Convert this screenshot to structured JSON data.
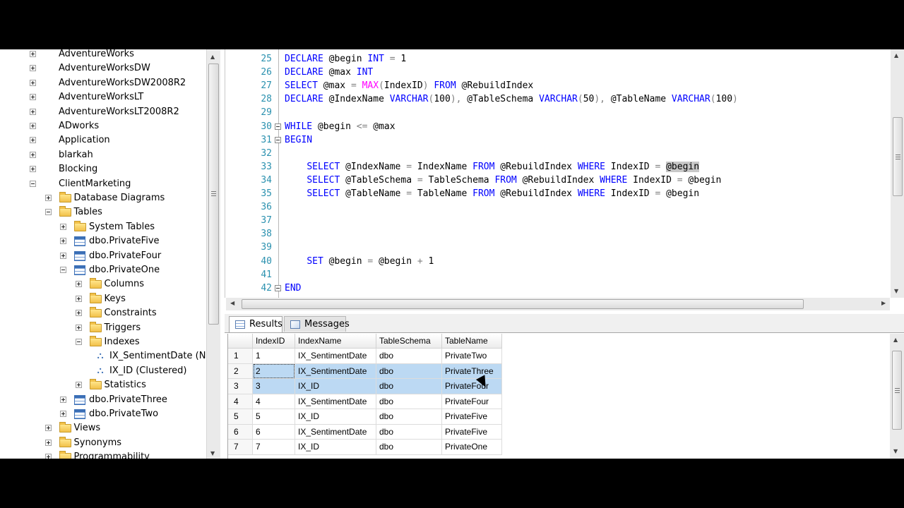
{
  "explorer": {
    "items": [
      {
        "label": "AdventureWorks",
        "icon": "database-icon",
        "expander": "plus",
        "level": 0
      },
      {
        "label": "AdventureWorksDW",
        "icon": "database-icon",
        "expander": "plus",
        "level": 0
      },
      {
        "label": "AdventureWorksDW2008R2",
        "icon": "database-icon",
        "expander": "plus",
        "level": 0
      },
      {
        "label": "AdventureWorksLT",
        "icon": "database-icon",
        "expander": "plus",
        "level": 0
      },
      {
        "label": "AdventureWorksLT2008R2",
        "icon": "database-icon",
        "expander": "plus",
        "level": 0
      },
      {
        "label": "ADworks",
        "icon": "database-icon",
        "expander": "plus",
        "level": 0
      },
      {
        "label": "Application",
        "icon": "database-icon",
        "expander": "plus",
        "level": 0
      },
      {
        "label": "blarkah",
        "icon": "database-icon",
        "expander": "plus",
        "level": 0
      },
      {
        "label": "Blocking",
        "icon": "database-icon",
        "expander": "plus",
        "level": 0
      },
      {
        "label": "ClientMarketing",
        "icon": "database-icon",
        "expander": "minus",
        "level": 0
      },
      {
        "label": "Database Diagrams",
        "icon": "folder-icon",
        "expander": "plus",
        "level": 1
      },
      {
        "label": "Tables",
        "icon": "folder-icon",
        "expander": "minus",
        "level": 1
      },
      {
        "label": "System Tables",
        "icon": "folder-icon",
        "expander": "plus",
        "level": 2
      },
      {
        "label": "dbo.PrivateFive",
        "icon": "table-icon",
        "expander": "plus",
        "level": 2
      },
      {
        "label": "dbo.PrivateFour",
        "icon": "table-icon",
        "expander": "plus",
        "level": 2
      },
      {
        "label": "dbo.PrivateOne",
        "icon": "table-icon",
        "expander": "minus",
        "level": 2
      },
      {
        "label": "Columns",
        "icon": "folder-icon",
        "expander": "plus",
        "level": 3
      },
      {
        "label": "Keys",
        "icon": "folder-icon",
        "expander": "plus",
        "level": 3
      },
      {
        "label": "Constraints",
        "icon": "folder-icon",
        "expander": "plus",
        "level": 3
      },
      {
        "label": "Triggers",
        "icon": "folder-icon",
        "expander": "plus",
        "level": 3
      },
      {
        "label": "Indexes",
        "icon": "folder-icon",
        "expander": "minus",
        "level": 3
      },
      {
        "label": "IX_SentimentDate (N",
        "icon": "index-icon",
        "expander": "none",
        "level": 4
      },
      {
        "label": "IX_ID (Clustered)",
        "icon": "index-icon",
        "expander": "none",
        "level": 4
      },
      {
        "label": "Statistics",
        "icon": "folder-icon",
        "expander": "plus",
        "level": 3
      },
      {
        "label": "dbo.PrivateThree",
        "icon": "table-icon",
        "expander": "plus",
        "level": 2
      },
      {
        "label": "dbo.PrivateTwo",
        "icon": "table-icon",
        "expander": "plus",
        "level": 2
      },
      {
        "label": "Views",
        "icon": "folder-icon",
        "expander": "plus",
        "level": 1
      },
      {
        "label": "Synonyms",
        "icon": "folder-icon",
        "expander": "plus",
        "level": 1
      },
      {
        "label": "Programmability",
        "icon": "folder-icon",
        "expander": "plus",
        "level": 1
      }
    ]
  },
  "editor": {
    "lines": [
      {
        "num": "25",
        "fold": false,
        "tokens": [
          [
            "k",
            "DECLARE"
          ],
          [
            "t",
            " @begin "
          ],
          [
            "k",
            "INT"
          ],
          [
            "t",
            " "
          ],
          [
            "g",
            "="
          ],
          [
            "t",
            " 1"
          ]
        ]
      },
      {
        "num": "26",
        "fold": false,
        "tokens": [
          [
            "k",
            "DECLARE"
          ],
          [
            "t",
            " @max "
          ],
          [
            "k",
            "INT"
          ]
        ]
      },
      {
        "num": "27",
        "fold": false,
        "tokens": [
          [
            "k",
            "SELECT"
          ],
          [
            "t",
            " @max "
          ],
          [
            "g",
            "="
          ],
          [
            "t",
            " "
          ],
          [
            "f",
            "MAX"
          ],
          [
            "g",
            "("
          ],
          [
            "t",
            "IndexID"
          ],
          [
            "g",
            ")"
          ],
          [
            "t",
            " "
          ],
          [
            "k",
            "FROM"
          ],
          [
            "t",
            " @RebuildIndex"
          ]
        ]
      },
      {
        "num": "28",
        "fold": false,
        "tokens": [
          [
            "k",
            "DECLARE"
          ],
          [
            "t",
            " @IndexName "
          ],
          [
            "k",
            "VARCHAR"
          ],
          [
            "g",
            "("
          ],
          [
            "t",
            "100"
          ],
          [
            "g",
            ")"
          ],
          [
            "g",
            ","
          ],
          [
            "t",
            " @TableSchema "
          ],
          [
            "k",
            "VARCHAR"
          ],
          [
            "g",
            "("
          ],
          [
            "t",
            "50"
          ],
          [
            "g",
            ")"
          ],
          [
            "g",
            ","
          ],
          [
            "t",
            " @TableName "
          ],
          [
            "k",
            "VARCHAR"
          ],
          [
            "g",
            "("
          ],
          [
            "t",
            "100"
          ],
          [
            "g",
            ")"
          ]
        ]
      },
      {
        "num": "29",
        "fold": false,
        "tokens": []
      },
      {
        "num": "30",
        "fold": true,
        "tokens": [
          [
            "k",
            "WHILE"
          ],
          [
            "t",
            " @begin "
          ],
          [
            "g",
            "<="
          ],
          [
            "t",
            " @max"
          ]
        ]
      },
      {
        "num": "31",
        "fold": true,
        "tokens": [
          [
            "k",
            "BEGIN"
          ]
        ]
      },
      {
        "num": "32",
        "fold": false,
        "tokens": []
      },
      {
        "num": "33",
        "fold": false,
        "tokens": [
          [
            "t",
            "    "
          ],
          [
            "k",
            "SELECT"
          ],
          [
            "t",
            " @IndexName "
          ],
          [
            "g",
            "="
          ],
          [
            "t",
            " IndexName "
          ],
          [
            "k",
            "FROM"
          ],
          [
            "t",
            " @RebuildIndex "
          ],
          [
            "k",
            "WHERE"
          ],
          [
            "t",
            " IndexID "
          ],
          [
            "g",
            "="
          ],
          [
            "t",
            " "
          ],
          [
            "hl",
            "@begin"
          ]
        ]
      },
      {
        "num": "34",
        "fold": false,
        "tokens": [
          [
            "t",
            "    "
          ],
          [
            "k",
            "SELECT"
          ],
          [
            "t",
            " @TableSchema "
          ],
          [
            "g",
            "="
          ],
          [
            "t",
            " TableSchema "
          ],
          [
            "k",
            "FROM"
          ],
          [
            "t",
            " @RebuildIndex "
          ],
          [
            "k",
            "WHERE"
          ],
          [
            "t",
            " IndexID "
          ],
          [
            "g",
            "="
          ],
          [
            "t",
            " @begin"
          ]
        ]
      },
      {
        "num": "35",
        "fold": false,
        "tokens": [
          [
            "t",
            "    "
          ],
          [
            "k",
            "SELECT"
          ],
          [
            "t",
            " @TableName "
          ],
          [
            "g",
            "="
          ],
          [
            "t",
            " TableName "
          ],
          [
            "k",
            "FROM"
          ],
          [
            "t",
            " @RebuildIndex "
          ],
          [
            "k",
            "WHERE"
          ],
          [
            "t",
            " IndexID "
          ],
          [
            "g",
            "="
          ],
          [
            "t",
            " @begin"
          ]
        ]
      },
      {
        "num": "36",
        "fold": false,
        "tokens": []
      },
      {
        "num": "37",
        "fold": false,
        "tokens": []
      },
      {
        "num": "38",
        "fold": false,
        "tokens": []
      },
      {
        "num": "39",
        "fold": false,
        "tokens": []
      },
      {
        "num": "40",
        "fold": false,
        "tokens": [
          [
            "t",
            "    "
          ],
          [
            "k",
            "SET"
          ],
          [
            "t",
            " @begin "
          ],
          [
            "g",
            "="
          ],
          [
            "t",
            " @begin "
          ],
          [
            "g",
            "+"
          ],
          [
            "t",
            " 1"
          ]
        ]
      },
      {
        "num": "41",
        "fold": false,
        "tokens": []
      },
      {
        "num": "42",
        "fold": true,
        "tokens": [
          [
            "k",
            "END"
          ]
        ]
      }
    ]
  },
  "results": {
    "tabs": {
      "results": "Results",
      "messages": "Messages"
    },
    "columns": [
      "IndexID",
      "IndexName",
      "TableSchema",
      "TableName"
    ],
    "rows": [
      {
        "rn": "1",
        "cells": [
          "1",
          "IX_SentimentDate",
          "dbo",
          "PrivateTwo"
        ],
        "selected": false
      },
      {
        "rn": "2",
        "cells": [
          "2",
          "IX_SentimentDate",
          "dbo",
          "PrivateThree"
        ],
        "selected": true
      },
      {
        "rn": "3",
        "cells": [
          "3",
          "IX_ID",
          "dbo",
          "PrivateFour"
        ],
        "selected": true
      },
      {
        "rn": "4",
        "cells": [
          "4",
          "IX_SentimentDate",
          "dbo",
          "PrivateFour"
        ],
        "selected": false
      },
      {
        "rn": "5",
        "cells": [
          "5",
          "IX_ID",
          "dbo",
          "PrivateFive"
        ],
        "selected": false
      },
      {
        "rn": "6",
        "cells": [
          "6",
          "IX_SentimentDate",
          "dbo",
          "PrivateFive"
        ],
        "selected": false
      },
      {
        "rn": "7",
        "cells": [
          "7",
          "IX_ID",
          "dbo",
          "PrivateOne"
        ],
        "selected": false
      }
    ]
  }
}
